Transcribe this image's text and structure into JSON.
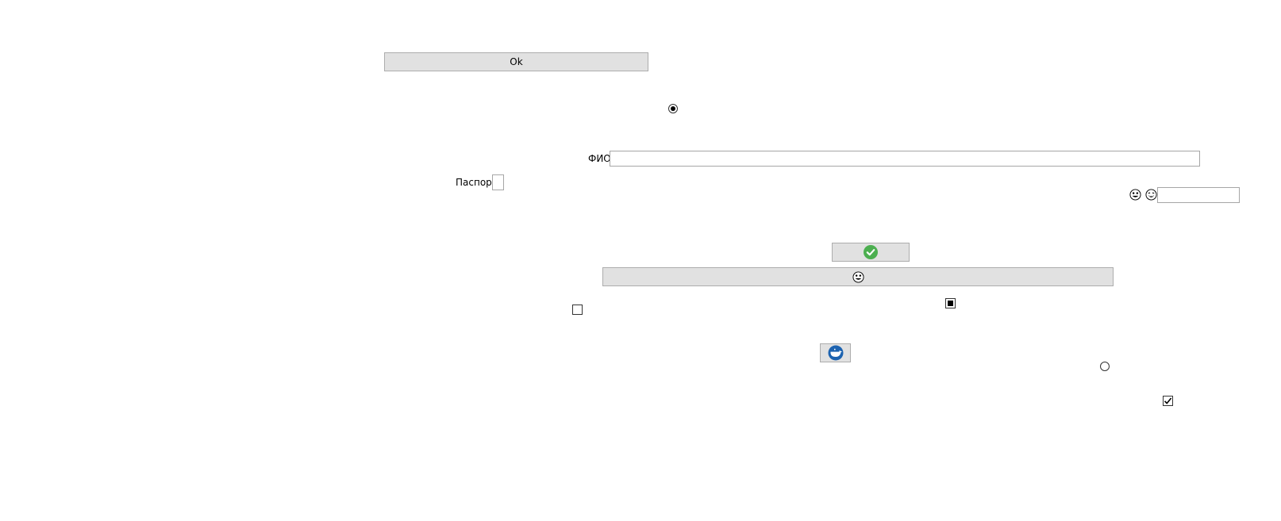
{
  "buttons": {
    "ok_label": "Ok"
  },
  "labels": {
    "fio": "ФИО",
    "passport": "Паспорт"
  },
  "inputs": {
    "fio_value": "",
    "passport_value": "",
    "small_value": ""
  },
  "controls": {
    "radio_top_checked": true,
    "radio_bottom_checked": false,
    "checkbox_left_checked": false,
    "checkbox_indeterminate": true,
    "checkbox_bottom_checked": true
  },
  "icons": {
    "check_button_icon": "green-check-icon",
    "face_button_icon": "smiley-face-icon",
    "docker_button_icon": "docker-whale-icon",
    "face_icon_1": "grinning-face-icon",
    "face_icon_2": "laughing-face-icon"
  },
  "colors": {
    "button_bg": "#e1e1e1",
    "button_border": "#adadad",
    "check_green": "#4caf50",
    "docker_blue": "#1d63b0"
  }
}
